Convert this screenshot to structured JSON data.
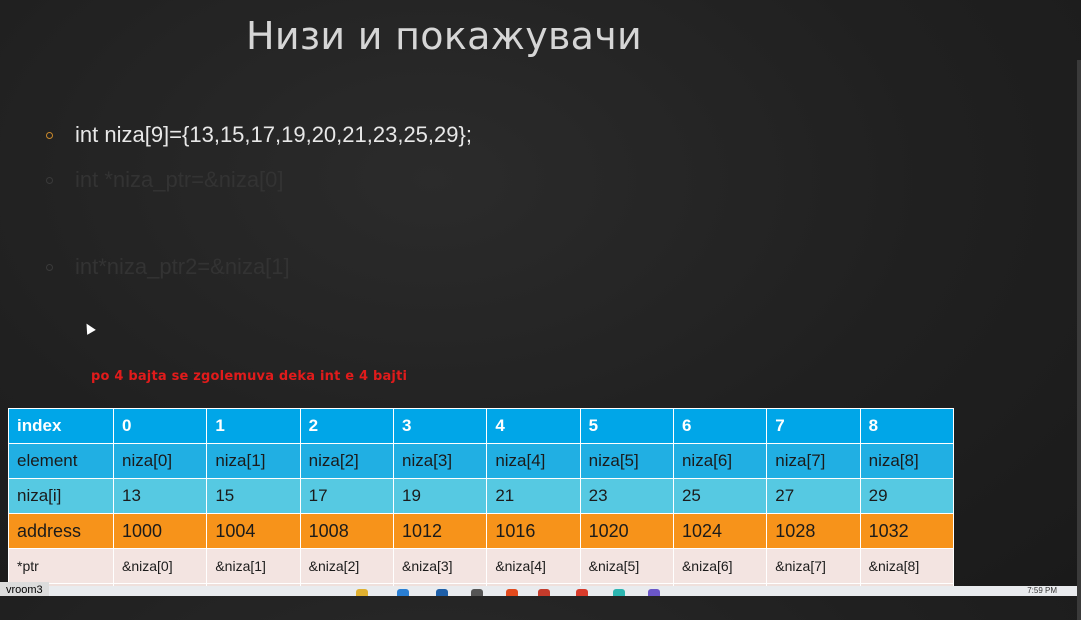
{
  "slide": {
    "title": "Низи и покажувачи",
    "bullets": [
      "int niza[9]={13,15,17,19,20,21,23,25,29};",
      "int *niza_ptr=&niza[0]",
      "int*niza_ptr2=&niza[1]"
    ],
    "note": "po 4 bajta se zgolemuva deka int e 4 bajti"
  },
  "table": {
    "index_row": [
      "index",
      "0",
      "1",
      "2",
      "3",
      "4",
      "5",
      "6",
      "7",
      "8"
    ],
    "element_row": [
      "element",
      "niza[0]",
      "niza[1]",
      "niza[2]",
      "niza[3]",
      "niza[4]",
      "niza[5]",
      "niza[6]",
      "niza[7]",
      "niza[8]"
    ],
    "value_row": [
      "niza[i]",
      "13",
      "15",
      "17",
      "19",
      "21",
      "23",
      "25",
      "27",
      "29"
    ],
    "address_row": [
      "address",
      "1000",
      "1004",
      "1008",
      "1012",
      "1016",
      "1020",
      "1024",
      "1028",
      "1032"
    ],
    "ptr_row": [
      "*ptr",
      "&niza[0]",
      "&niza[1]",
      "&niza[2]",
      "&niza[3]",
      "&niza[4]",
      "&niza[5]",
      "&niza[6]",
      "&niza[7]",
      "&niza[8]"
    ]
  },
  "taskbar": {
    "app_label": "vroom3",
    "clock": "7:59 PM"
  },
  "colors": {
    "index_bg": "#00a6e8",
    "element_bg": "#21afe3",
    "value_bg": "#56c9e2",
    "address_bg": "#f7931a",
    "ptr_bg": "#f3e4e1",
    "note_color": "#e11b1b",
    "bullet_accent": "#c9882b"
  }
}
